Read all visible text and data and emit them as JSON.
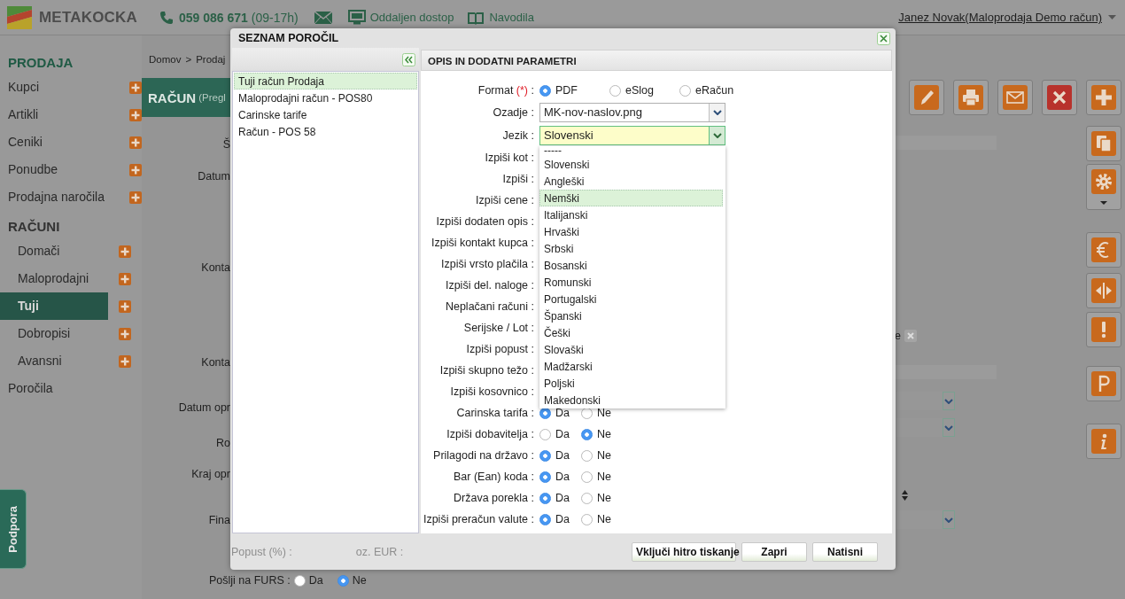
{
  "header": {
    "logo_text": "METAKOCKA",
    "phone": "059 086 671",
    "phone_hours": "(09-17h)",
    "remote_access": "Oddaljen dostop",
    "guide": "Navodila",
    "user": "Janez Novak(Maloprodaja Demo račun)"
  },
  "sidebar": {
    "sections": [
      {
        "title": "PRODAJA",
        "kind": "main",
        "items": [
          {
            "label": "Kupci",
            "selected": false
          },
          {
            "label": "Artikli",
            "selected": false
          },
          {
            "label": "Ceniki",
            "selected": false
          },
          {
            "label": "Ponudbe",
            "selected": false
          },
          {
            "label": "Prodajna naročila",
            "selected": false
          }
        ]
      },
      {
        "title": "RAČUNI",
        "kind": "group",
        "items": [
          {
            "label": "Domači",
            "selected": false
          },
          {
            "label": "Maloprodajni",
            "selected": false
          },
          {
            "label": "Tuji",
            "selected": true
          },
          {
            "label": "Dobropisi",
            "selected": false
          },
          {
            "label": "Avansni",
            "selected": false
          }
        ]
      },
      {
        "title": "Poročila",
        "kind": "link"
      }
    ]
  },
  "support_tab": "Podpora",
  "page": {
    "breadcrumb": [
      "Domov",
      ">",
      "Prodaj"
    ],
    "title": "RAČUN",
    "title_note": "(Pregl",
    "form_labels": [
      "Š",
      "Datum",
      "Konta",
      "Konta",
      "Datum opr",
      "Ro",
      "Kraj opr",
      "Fina"
    ],
    "trailing_text": "e",
    "furs": {
      "label": "Pošlji na FURS :",
      "options": [
        {
          "label": "Da",
          "selected": false
        },
        {
          "label": "Ne",
          "selected": true
        }
      ]
    }
  },
  "dialog": {
    "title": "SEZNAM POROČIL",
    "reports": [
      {
        "label": "Tuji račun Prodaja",
        "selected": true
      },
      {
        "label": "Maloprodajni račun - POS80",
        "selected": false
      },
      {
        "label": "Carinske tarife",
        "selected": false
      },
      {
        "label": "Račun - POS 58",
        "selected": false
      }
    ],
    "panel_title": "OPIS IN DODATNI PARAMETRI",
    "format": {
      "label": "Format",
      "required_mark": "(*)",
      "colon": ":",
      "options": [
        {
          "label": "PDF",
          "selected": true
        },
        {
          "label": "eSlog",
          "selected": false
        },
        {
          "label": "eRačun",
          "selected": false
        }
      ]
    },
    "background_field": {
      "label": "Ozadje :",
      "value": "MK-nov-naslov.png",
      "focused": false
    },
    "language_field": {
      "label": "Jezik :",
      "value": "Slovenski",
      "focused": true
    },
    "language_options": [
      {
        "label": "-----",
        "selected": false
      },
      {
        "label": "Slovenski",
        "selected": false
      },
      {
        "label": "Angleški",
        "selected": false
      },
      {
        "label": "Nemški",
        "selected": true
      },
      {
        "label": "Italijanski",
        "selected": false
      },
      {
        "label": "Hrvaški",
        "selected": false
      },
      {
        "label": "Srbski",
        "selected": false
      },
      {
        "label": "Bosanski",
        "selected": false
      },
      {
        "label": "Romunski",
        "selected": false
      },
      {
        "label": "Portugalski",
        "selected": false
      },
      {
        "label": "Španski",
        "selected": false
      },
      {
        "label": "Češki",
        "selected": false
      },
      {
        "label": "Slovaški",
        "selected": false
      },
      {
        "label": "Madžarski",
        "selected": false
      },
      {
        "label": "Poljski",
        "selected": false
      },
      {
        "label": "Makedonski",
        "selected": false
      }
    ],
    "rows": [
      {
        "label": "Izpiši kot :"
      },
      {
        "label": "Izpiši :"
      },
      {
        "label": "Izpiši cene :"
      },
      {
        "label": "Izpiši dodaten opis :"
      },
      {
        "label": "Izpiši kontakt kupca :"
      },
      {
        "label": "Izpiši vrsto plačila :"
      },
      {
        "label": "Izpiši del. naloge :"
      },
      {
        "label": "Neplačani računi :"
      },
      {
        "label": "Serijske / Lot :"
      },
      {
        "label": "Izpiši popust :"
      },
      {
        "label": "Izpiši skupno težo :"
      },
      {
        "label": "Izpiši kosovnico :"
      },
      {
        "label": "Carinska tarifa :",
        "options": [
          {
            "label": "Da",
            "selected": true
          },
          {
            "label": "Ne",
            "selected": false
          }
        ]
      },
      {
        "label": "Izpiši dobavitelja :",
        "options": [
          {
            "label": "Da",
            "selected": false
          },
          {
            "label": "Ne",
            "selected": true
          }
        ]
      },
      {
        "label": "Prilagodi na državo :",
        "options": [
          {
            "label": "Da",
            "selected": true
          },
          {
            "label": "Ne",
            "selected": false
          }
        ]
      },
      {
        "label": "Bar (Ean) koda :",
        "options": [
          {
            "label": "Da",
            "selected": true
          },
          {
            "label": "Ne",
            "selected": false
          }
        ]
      },
      {
        "label": "Država porekla :",
        "options": [
          {
            "label": "Da",
            "selected": true
          },
          {
            "label": "Ne",
            "selected": false
          }
        ]
      },
      {
        "label": "Izpiši preračun valute :",
        "options": [
          {
            "label": "Da",
            "selected": true
          },
          {
            "label": "Ne",
            "selected": false
          }
        ]
      }
    ],
    "faded_labels": [
      "Popust (%) :",
      "oz. EUR :"
    ],
    "buttons": [
      "Vključi hitro tiskanje",
      "Zapri",
      "Natisni"
    ]
  }
}
